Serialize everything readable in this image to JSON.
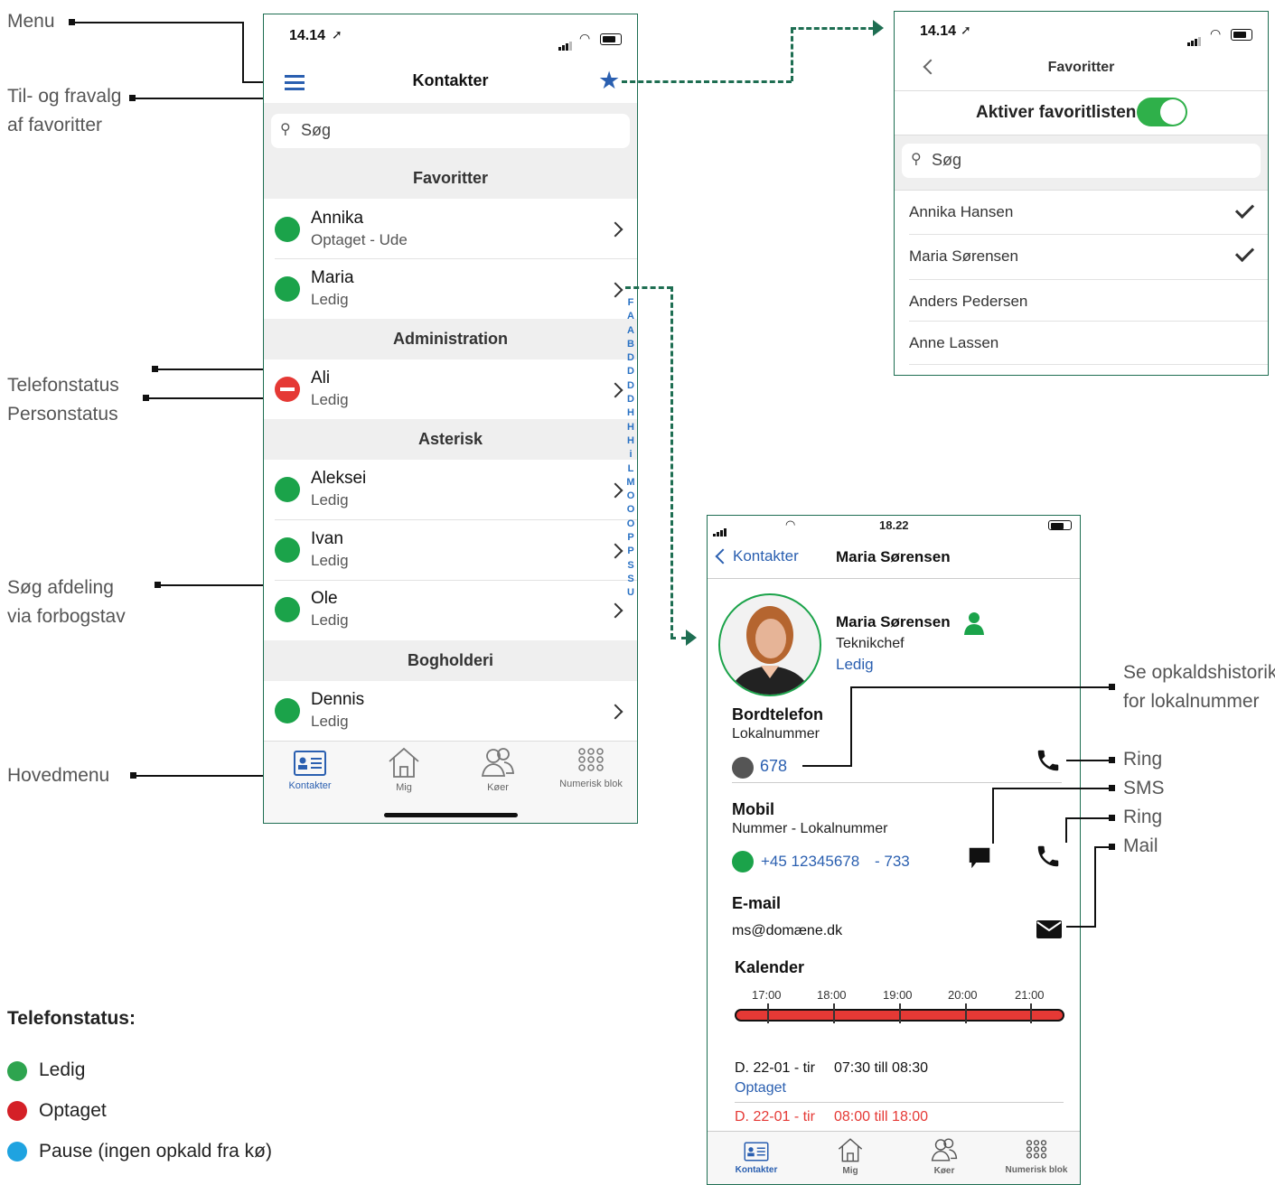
{
  "callouts": {
    "menu": "Menu",
    "favorites_1": "Til- og fravalg",
    "favorites_2": "af favoritter",
    "phone_status": "Telefonstatus",
    "person_status": "Personstatus",
    "search_dept_1": "Søg afdeling",
    "search_dept_2": "via forbogstav",
    "main_menu": "Hovedmenu",
    "call_history_1": "Se opkaldshistorik",
    "call_history_2": "for lokalnummer",
    "ring1": "Ring",
    "sms": "SMS",
    "ring2": "Ring",
    "mail": "Mail"
  },
  "legend": {
    "title": "Telefonstatus:",
    "items": [
      {
        "label": "Ledig",
        "color": "#2ea44f"
      },
      {
        "label": "Optaget",
        "color": "#d42027"
      },
      {
        "label": "Pause (ingen opkald fra kø)",
        "color": "#1fa3e0"
      }
    ]
  },
  "phone1": {
    "time": "14.14",
    "title": "Kontakter",
    "search_placeholder": "Søg",
    "sections": [
      {
        "header": "Favoritter",
        "rows": [
          {
            "name": "Annika",
            "status": "Optaget - Ude",
            "dot": "green"
          },
          {
            "name": "Maria",
            "status": "Ledig",
            "dot": "green"
          }
        ]
      },
      {
        "header": "Administration",
        "rows": [
          {
            "name": "Ali",
            "status": "Ledig",
            "dot": "red"
          }
        ]
      },
      {
        "header": "Asterisk",
        "rows": [
          {
            "name": "Aleksei",
            "status": "Ledig",
            "dot": "green"
          },
          {
            "name": "Ivan",
            "status": "Ledig",
            "dot": "green"
          },
          {
            "name": "Ole",
            "status": "Ledig",
            "dot": "green"
          }
        ]
      },
      {
        "header": "Bogholderi",
        "rows": [
          {
            "name": "Dennis",
            "status": "Ledig",
            "dot": "green"
          }
        ]
      }
    ],
    "alphabet": [
      "F",
      "A",
      "A",
      "B",
      "D",
      "D",
      "D",
      "D",
      "H",
      "H",
      "H",
      "i",
      "L",
      "M",
      "O",
      "O",
      "O",
      "P",
      "P",
      "S",
      "S",
      "U"
    ],
    "tabs": [
      "Kontakter",
      "Mig",
      "Køer",
      "Numerisk blok"
    ]
  },
  "phone2": {
    "time": "14.14",
    "title": "Favoritter",
    "toggle_label": "Aktiver favoritlisten",
    "toggle_on": true,
    "search_placeholder": "Søg",
    "items": [
      {
        "name": "Annika Hansen",
        "checked": true
      },
      {
        "name": "Maria Sørensen",
        "checked": true
      },
      {
        "name": "Anders Pedersen",
        "checked": false
      },
      {
        "name": "Anne Lassen",
        "checked": false
      }
    ]
  },
  "phone3": {
    "time": "18.22",
    "back_label": "Kontakter",
    "title": "Maria Sørensen",
    "profile": {
      "name": "Maria Sørensen",
      "role": "Teknikchef",
      "status": "Ledig"
    },
    "desk": {
      "heading": "Bordtelefon",
      "sub": "Lokalnummer",
      "number": "678"
    },
    "mobile": {
      "heading": "Mobil",
      "sub": "Nummer - Lokalnummer",
      "number": "+45 12345678",
      "ext": "- 733"
    },
    "email": {
      "heading": "E-mail",
      "address": "ms@domæne.dk"
    },
    "calendar": {
      "heading": "Kalender",
      "times": [
        "17:00",
        "18:00",
        "19:00",
        "20:00",
        "21:00"
      ],
      "entries": [
        {
          "date": "D. 22-01 - tir",
          "time": "07:30 till 08:30",
          "status": "Optaget"
        },
        {
          "date": "D. 22-01 - tir",
          "time": "08:00 till 18:00"
        }
      ]
    },
    "tabs": [
      "Kontakter",
      "Mig",
      "Køer",
      "Numerisk blok"
    ]
  },
  "colors": {
    "accent_green": "#1e6e52",
    "status_green": "#1ba34a",
    "status_red": "#e53935",
    "link_blue": "#2a5fb0"
  }
}
